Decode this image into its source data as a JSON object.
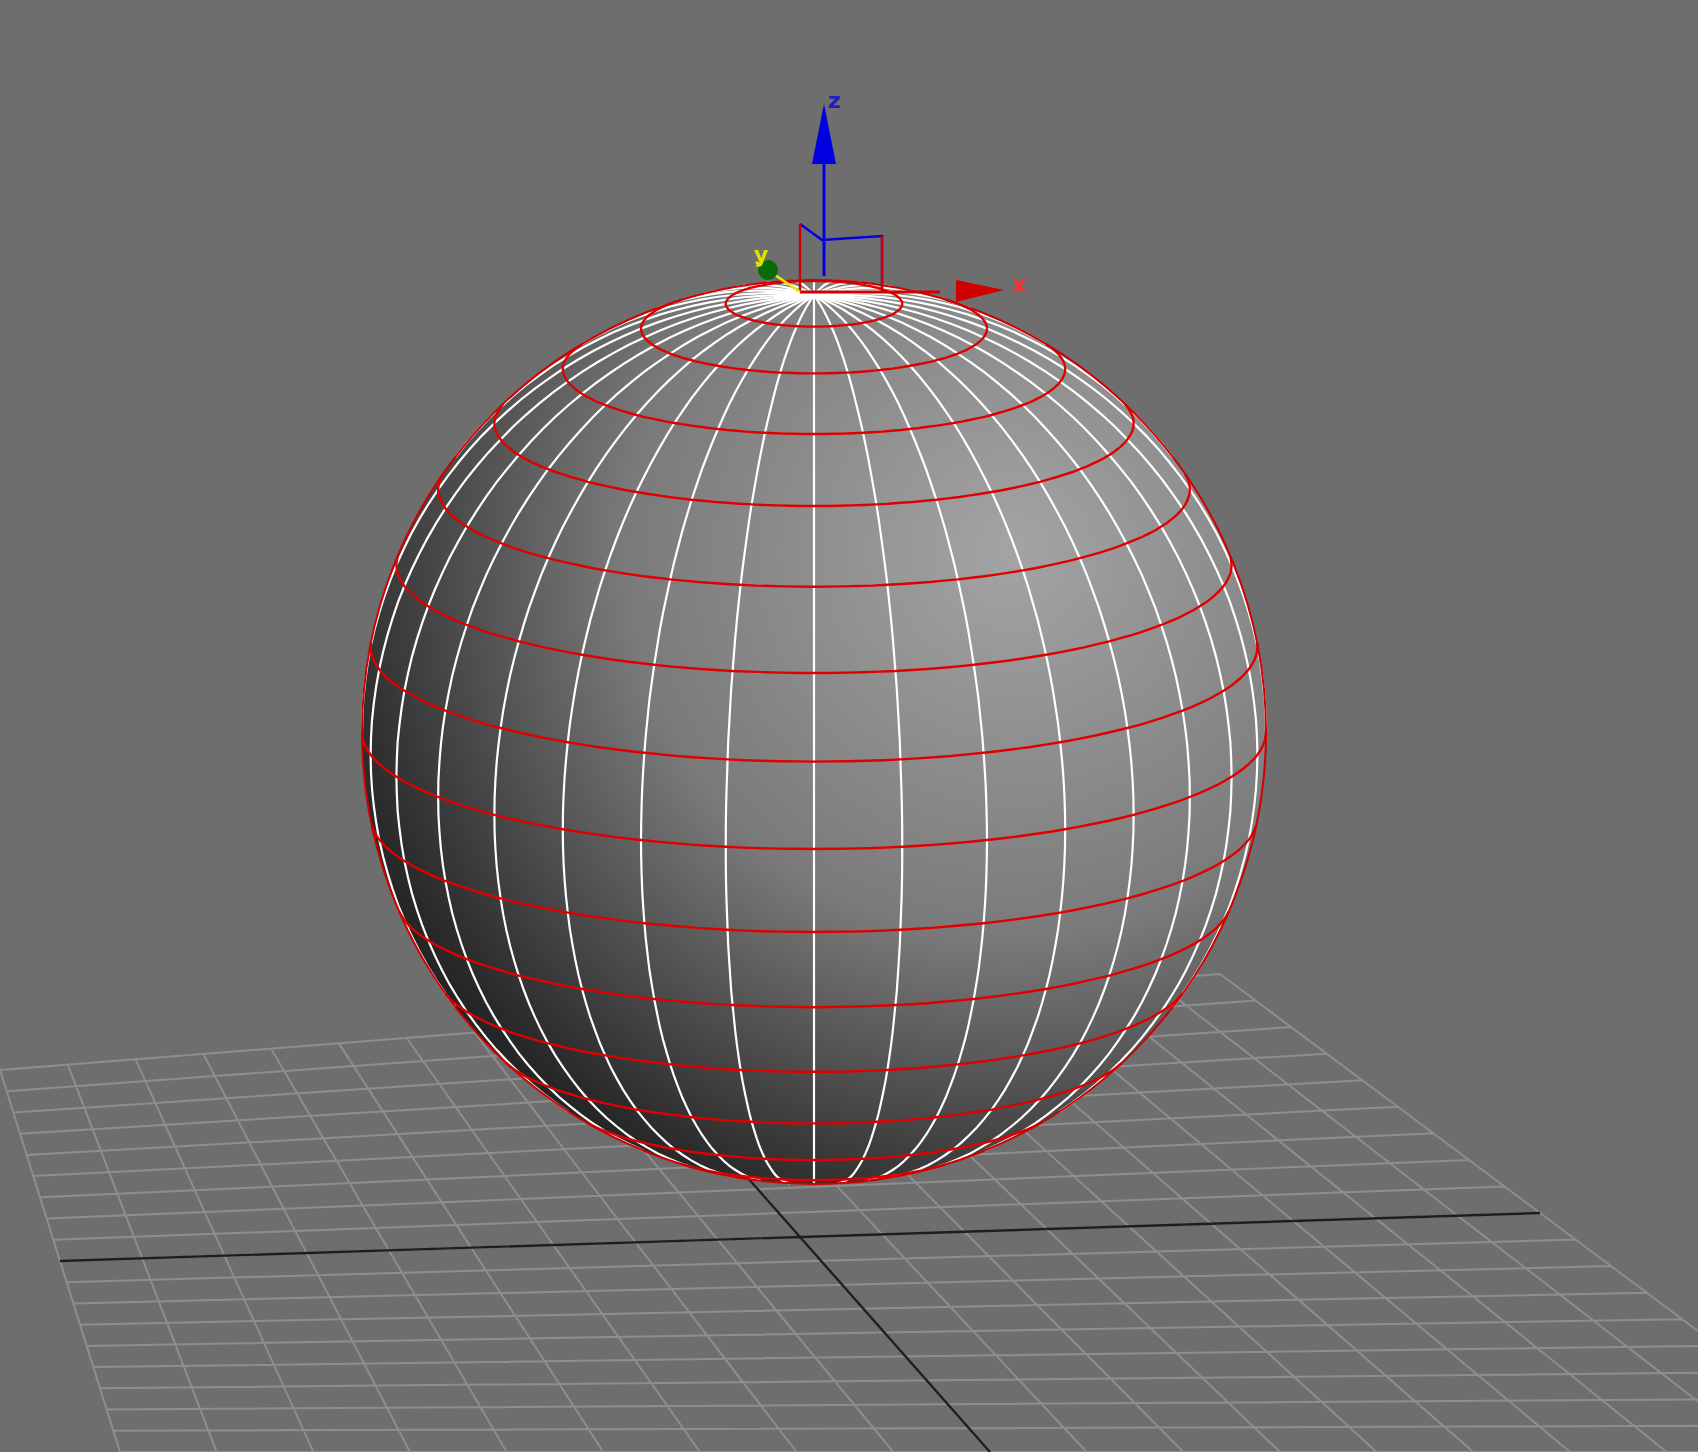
{
  "viewport": {
    "gizmo": {
      "axes": [
        {
          "kind": "z",
          "label": "z"
        },
        {
          "kind": "x",
          "label": "x"
        },
        {
          "kind": "y",
          "label": "y"
        }
      ]
    }
  }
}
